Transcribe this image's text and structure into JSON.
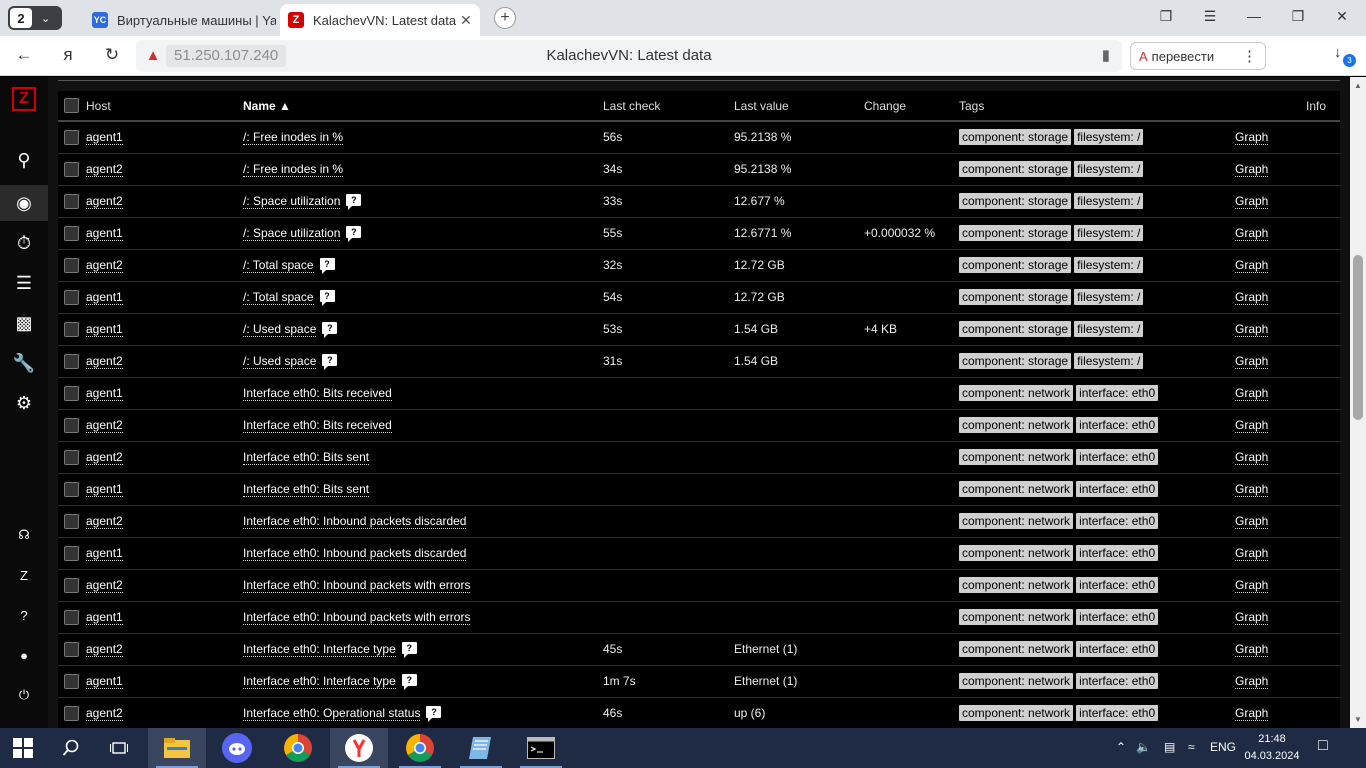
{
  "browser": {
    "tab_count": "2",
    "tabs": [
      {
        "title": "Виртуальные машины | Ya",
        "icon": "yc-icon"
      },
      {
        "title": "KalachevVN: Latest data",
        "icon": "zabbix-icon",
        "active": true
      }
    ],
    "url_host": "51.250.107.240",
    "page_title": "KalachevVN: Latest data",
    "translate_label": "перевести",
    "downloads_badge": "3"
  },
  "table": {
    "headers": {
      "host": "Host",
      "name": "Name ▲",
      "last_check": "Last check",
      "last_value": "Last value",
      "change": "Change",
      "tags": "Tags",
      "info": "Info"
    },
    "graph_label": "Graph",
    "rows": [
      {
        "host": "agent1",
        "name": "/: Free inodes in %",
        "info": false,
        "last_check": "56s",
        "last_value": "95.2138 %",
        "change": "",
        "tags": [
          "component: storage",
          "filesystem: /"
        ]
      },
      {
        "host": "agent2",
        "name": "/: Free inodes in %",
        "info": false,
        "last_check": "34s",
        "last_value": "95.2138 %",
        "change": "",
        "tags": [
          "component: storage",
          "filesystem: /"
        ]
      },
      {
        "host": "agent2",
        "name": "/: Space utilization",
        "info": true,
        "last_check": "33s",
        "last_value": "12.677 %",
        "change": "",
        "tags": [
          "component: storage",
          "filesystem: /"
        ]
      },
      {
        "host": "agent1",
        "name": "/: Space utilization",
        "info": true,
        "last_check": "55s",
        "last_value": "12.6771 %",
        "change": "+0.000032 %",
        "tags": [
          "component: storage",
          "filesystem: /"
        ]
      },
      {
        "host": "agent2",
        "name": "/: Total space",
        "info": true,
        "last_check": "32s",
        "last_value": "12.72 GB",
        "change": "",
        "tags": [
          "component: storage",
          "filesystem: /"
        ]
      },
      {
        "host": "agent1",
        "name": "/: Total space",
        "info": true,
        "last_check": "54s",
        "last_value": "12.72 GB",
        "change": "",
        "tags": [
          "component: storage",
          "filesystem: /"
        ]
      },
      {
        "host": "agent1",
        "name": "/: Used space",
        "info": true,
        "last_check": "53s",
        "last_value": "1.54 GB",
        "change": "+4 KB",
        "tags": [
          "component: storage",
          "filesystem: /"
        ]
      },
      {
        "host": "agent2",
        "name": "/: Used space",
        "info": true,
        "last_check": "31s",
        "last_value": "1.54 GB",
        "change": "",
        "tags": [
          "component: storage",
          "filesystem: /"
        ]
      },
      {
        "host": "agent1",
        "name": "Interface eth0: Bits received",
        "info": false,
        "last_check": "",
        "last_value": "",
        "change": "",
        "tags": [
          "component: network",
          "interface: eth0"
        ]
      },
      {
        "host": "agent2",
        "name": "Interface eth0: Bits received",
        "info": false,
        "last_check": "",
        "last_value": "",
        "change": "",
        "tags": [
          "component: network",
          "interface: eth0"
        ]
      },
      {
        "host": "agent2",
        "name": "Interface eth0: Bits sent",
        "info": false,
        "last_check": "",
        "last_value": "",
        "change": "",
        "tags": [
          "component: network",
          "interface: eth0"
        ]
      },
      {
        "host": "agent1",
        "name": "Interface eth0: Bits sent",
        "info": false,
        "last_check": "",
        "last_value": "",
        "change": "",
        "tags": [
          "component: network",
          "interface: eth0"
        ]
      },
      {
        "host": "agent2",
        "name": "Interface eth0: Inbound packets discarded",
        "info": false,
        "last_check": "",
        "last_value": "",
        "change": "",
        "tags": [
          "component: network",
          "interface: eth0"
        ]
      },
      {
        "host": "agent1",
        "name": "Interface eth0: Inbound packets discarded",
        "info": false,
        "last_check": "",
        "last_value": "",
        "change": "",
        "tags": [
          "component: network",
          "interface: eth0"
        ]
      },
      {
        "host": "agent2",
        "name": "Interface eth0: Inbound packets with errors",
        "info": false,
        "last_check": "",
        "last_value": "",
        "change": "",
        "tags": [
          "component: network",
          "interface: eth0"
        ]
      },
      {
        "host": "agent1",
        "name": "Interface eth0: Inbound packets with errors",
        "info": false,
        "last_check": "",
        "last_value": "",
        "change": "",
        "tags": [
          "component: network",
          "interface: eth0"
        ]
      },
      {
        "host": "agent2",
        "name": "Interface eth0: Interface type",
        "info": true,
        "last_check": "45s",
        "last_value": "Ethernet (1)",
        "change": "",
        "tags": [
          "component: network",
          "interface: eth0"
        ]
      },
      {
        "host": "agent1",
        "name": "Interface eth0: Interface type",
        "info": true,
        "last_check": "1m 7s",
        "last_value": "Ethernet (1)",
        "change": "",
        "tags": [
          "component: network",
          "interface: eth0"
        ]
      },
      {
        "host": "agent2",
        "name": "Interface eth0: Operational status",
        "info": true,
        "last_check": "46s",
        "last_value": "up (6)",
        "change": "",
        "tags": [
          "component: network",
          "interface: eth0"
        ]
      }
    ]
  },
  "taskbar": {
    "language": "ENG",
    "time": "21:48",
    "date": "04.03.2024"
  },
  "colors": {
    "zabbix_red": "#d40000",
    "table_bg": "#000000",
    "tag_bg": "#cfcfcf",
    "taskbar_bg": "#1f2a44"
  }
}
